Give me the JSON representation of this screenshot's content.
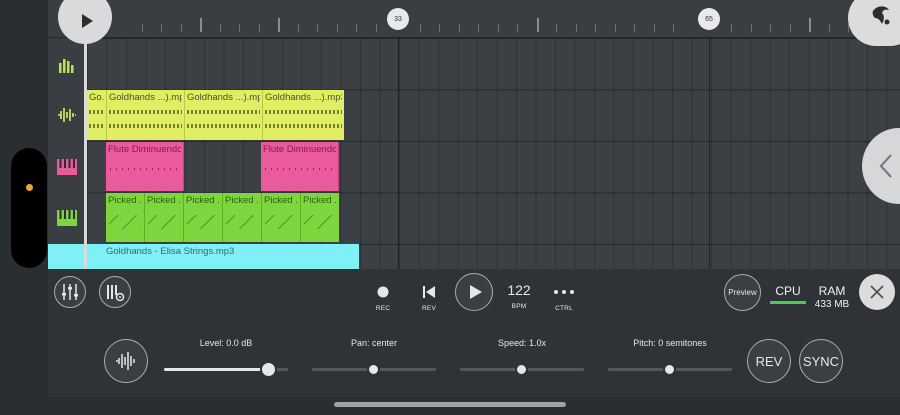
{
  "ruler": {
    "markers": [
      "33",
      "65"
    ]
  },
  "playlist": {
    "clips": {
      "audio": [
        "Go...",
        "Goldhands ...).mp3",
        "Goldhands ...).mp3",
        "Goldhands ...).mp3"
      ],
      "flute": [
        "Flute Diminuendo",
        "Flute Diminuendo"
      ],
      "picked": [
        "Picked ...",
        "Picked ...",
        "Picked ...",
        "Picked ...",
        "Picked ...",
        "Picked ..."
      ],
      "strings": "Goldhands - Elisa Strings.mp3"
    }
  },
  "transport": {
    "rec_label": "REC",
    "rev_label": "REV",
    "bpm_value": "122",
    "bpm_label": "BPM",
    "ctrl_label": "CTRL",
    "preview_label": "Preview",
    "cpu_label": "CPU",
    "ram_label": "RAM",
    "ram_value": "433 MB"
  },
  "sample_controls": {
    "level": {
      "label": "Level: 0.0 dB",
      "position": 0.85
    },
    "pan": {
      "label": "Pan: center",
      "position": 0.5
    },
    "speed": {
      "label": "Speed: 1.0x",
      "position": 0.5
    },
    "pitch": {
      "label": "Pitch: 0 semitones",
      "position": 0.5
    },
    "rev_button": "REV",
    "sync_button": "SYNC"
  },
  "colors": {
    "audio_clip": "#dfee63",
    "flute_clip": "#ea5a9c",
    "picked_clip": "#7ed63f",
    "strings_clip": "#7ef0f6",
    "cpu_bar": "#3fd33f",
    "side_dot": "#f2a13a"
  },
  "icons": {
    "play": "play-icon",
    "record": "record-icon",
    "rewind": "skip-back-icon",
    "ctrl": "more-dots-icon",
    "close": "close-icon",
    "back": "chevron-left-icon",
    "waveform": "waveform-icon",
    "mixer": "mixer-sliders-icon",
    "piano_settings": "piano-settings-icon",
    "logo": "fruit-logo-icon"
  }
}
